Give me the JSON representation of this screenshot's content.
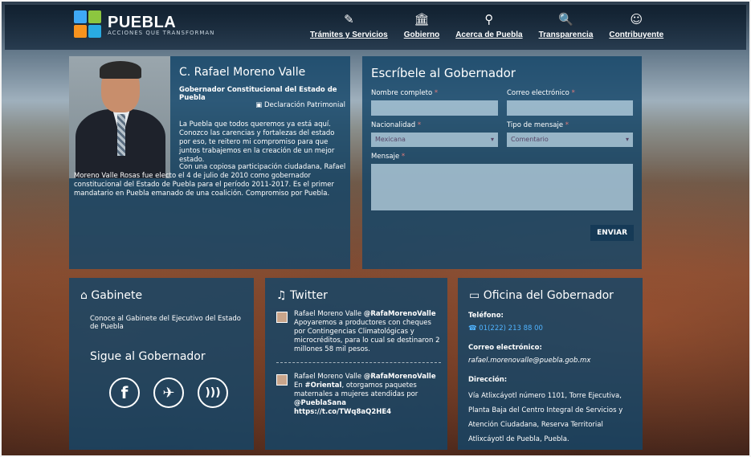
{
  "header": {
    "logo_title": "PUEBLA",
    "logo_subtitle": "ACCIONES QUE TRANSFORMAN",
    "nav": [
      {
        "label": "Trámites y Servicios",
        "icon": "✎"
      },
      {
        "label": "Gobierno",
        "icon": "🏛"
      },
      {
        "label": "Acerca de Puebla",
        "icon": "⚲"
      },
      {
        "label": "Transparencia",
        "icon": "🔍"
      },
      {
        "label": "Contribuyente",
        "icon": "☺"
      }
    ]
  },
  "governor": {
    "name": "C. Rafael Moreno Valle",
    "title": "Gobernador Constitucional del Estado de Puebla",
    "declaration": "Declaración Patrimonial",
    "paragraph1": "La Puebla que todos queremos ya está aquí. Conozco las carencias y fortalezas del estado por eso, te reitero mi compromiso para que juntos trabajemos en la creación de un mejor estado.",
    "paragraph2": "Con una copiosa participación ciudadana, Rafael Moreno Valle Rosas fue electo el 4 de julio de 2010 como gobernador constitucional del Estado de Puebla para el período 2011-2017. Es el primer mandatario en Puebla emanado de una coalición. Compromiso por Puebla."
  },
  "form": {
    "title": "Escríbele al Gobernador",
    "name_label": "Nombre completo",
    "email_label": "Correo electrónico",
    "nationality_label": "Nacionalidad",
    "nationality_value": "Mexicana",
    "type_label": "Tipo de mensaje",
    "type_value": "Comentario",
    "message_label": "Mensaje",
    "required_mark": "*",
    "send_label": "ENVIAR"
  },
  "gabinete": {
    "title": "Gabinete",
    "text": "Conoce al Gabinete del Ejecutivo del Estado de Puebla",
    "follow_title": "Sigue al Gobernador",
    "social": [
      "f",
      "t",
      "rss"
    ]
  },
  "twitter": {
    "title": "Twitter",
    "tweets": [
      {
        "author": "Rafael Moreno Valle",
        "handle": "@RafaMorenoValle",
        "text": "Apoyaremos a productores con cheques por Contingencias Climatológicas y microcréditos, para lo cual se destinaron 2 millones 58 mil pesos."
      },
      {
        "author": "Rafael Moreno Valle",
        "handle": "@RafaMorenoValle",
        "text_pre": "En",
        "hashtag": "#Oriental",
        "text_mid": ", otorgamos paquetes maternales a mujeres atendidas por",
        "mention": "@PueblaSana",
        "link": "https://t.co/TWq8aQ2HE4"
      }
    ]
  },
  "office": {
    "title": "Oficina del Gobernador",
    "phone_label": "Teléfono:",
    "phone": "01(222) 213 88 00",
    "email_label": "Correo electrónico:",
    "email": "rafael.morenovalle@puebla.gob.mx",
    "address_label": "Dirección:",
    "address": "Vía Atlixcáyotl número 1101, Torre Ejecutiva, Planta Baja del Centro Integral de Servicios y Atención Ciudadana, Reserva Territorial Atlixcáyotl de Puebla, Puebla."
  }
}
